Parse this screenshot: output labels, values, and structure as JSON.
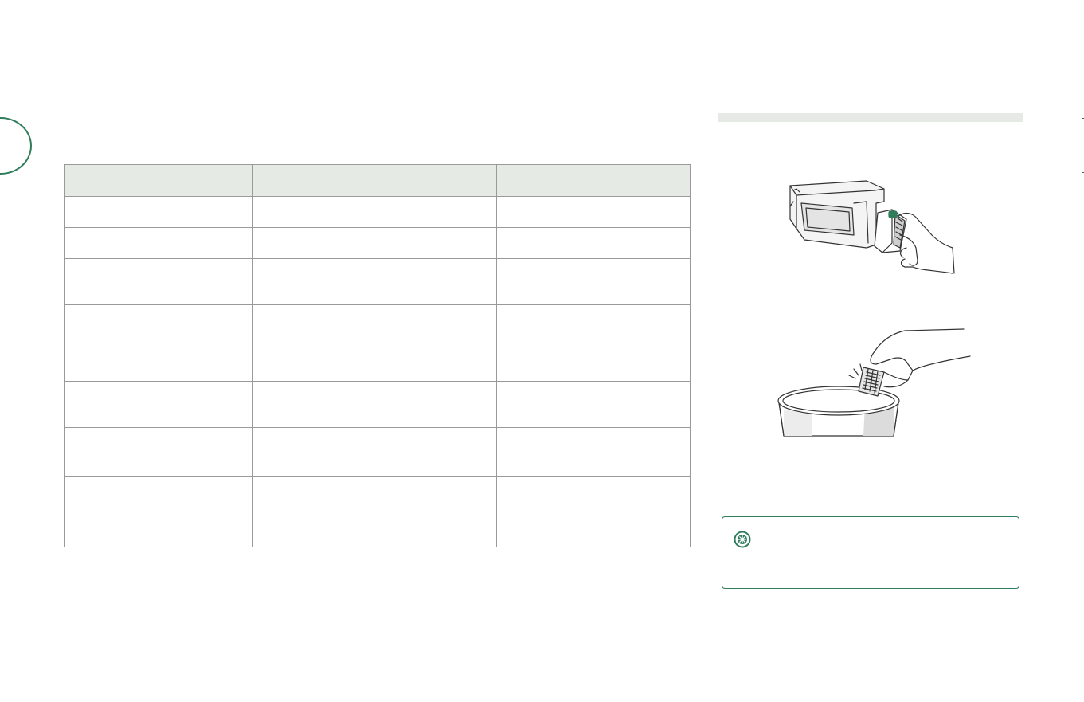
{
  "table": {
    "headers": [
      "",
      "",
      ""
    ],
    "rows": [
      [
        "",
        "",
        ""
      ],
      [
        "",
        "",
        ""
      ],
      [
        "",
        "",
        ""
      ],
      [
        "",
        "",
        ""
      ],
      [
        "",
        "",
        ""
      ],
      [
        "",
        "",
        ""
      ],
      [
        "",
        "",
        ""
      ],
      [
        "",
        "",
        ""
      ]
    ]
  },
  "note": {
    "icon": "asterisk-circle-icon",
    "text": ""
  },
  "illustrations": [
    {
      "icon": "robot-bin-filter-removal-illustration"
    },
    {
      "icon": "filter-into-trash-illustration"
    }
  ],
  "colors": {
    "accent_green": "#2f7d5b",
    "header_fill": "#e6eae4",
    "border_gray": "#9a9a9a"
  }
}
